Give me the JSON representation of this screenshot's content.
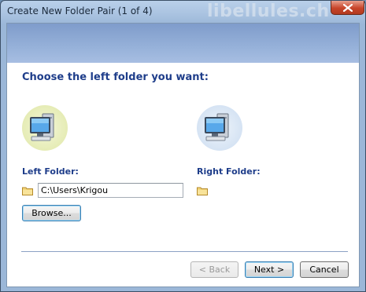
{
  "window": {
    "title": "Create New Folder Pair (1 of 4)",
    "watermark": "libellules.ch"
  },
  "content": {
    "heading": "Choose the left folder you want:",
    "left_folder_label": "Left Folder:",
    "right_folder_label": "Right Folder:",
    "left_folder_path": "C:\\Users\\Krigou",
    "browse_label": "Browse..."
  },
  "footer": {
    "back_label": "< Back",
    "next_label": "Next >",
    "cancel_label": "Cancel"
  },
  "colors": {
    "heading": "#1e3d8a",
    "banner": "#96b1d9",
    "close_button": "#c7452a"
  },
  "icons": [
    "close-icon",
    "computer-icon",
    "folder-icon"
  ]
}
